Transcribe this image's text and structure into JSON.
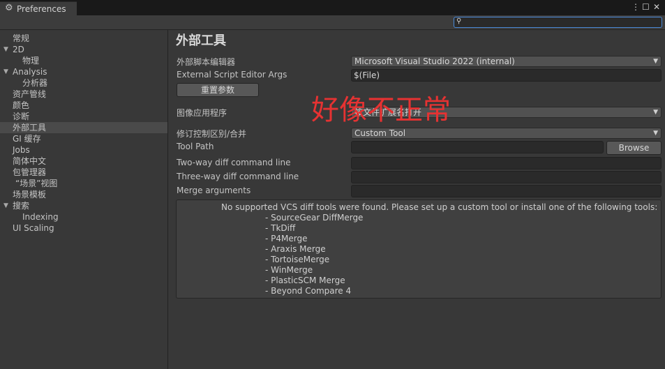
{
  "window": {
    "title": "Preferences",
    "buttons": [
      "⋮",
      "☐",
      "✕"
    ]
  },
  "search": {
    "value": "",
    "placeholder": ""
  },
  "sidebar": {
    "items": [
      {
        "label": "常规",
        "indent": 0,
        "arrow": "",
        "selected": false
      },
      {
        "label": "2D",
        "indent": 0,
        "arrow": "▼",
        "selected": false
      },
      {
        "label": "物理",
        "indent": 1,
        "arrow": "",
        "selected": false
      },
      {
        "label": "Analysis",
        "indent": 0,
        "arrow": "▼",
        "selected": false
      },
      {
        "label": "分析器",
        "indent": 1,
        "arrow": "",
        "selected": false
      },
      {
        "label": "资产管线",
        "indent": 0,
        "arrow": "",
        "selected": false
      },
      {
        "label": "颜色",
        "indent": 0,
        "arrow": "",
        "selected": false
      },
      {
        "label": "诊断",
        "indent": 0,
        "arrow": "",
        "selected": false
      },
      {
        "label": "外部工具",
        "indent": 0,
        "arrow": "",
        "selected": true
      },
      {
        "label": "GI 缓存",
        "indent": 0,
        "arrow": "",
        "selected": false
      },
      {
        "label": "Jobs",
        "indent": 0,
        "arrow": "",
        "selected": false
      },
      {
        "label": "简体中文",
        "indent": 0,
        "arrow": "",
        "selected": false
      },
      {
        "label": "包管理器",
        "indent": 0,
        "arrow": "",
        "selected": false
      },
      {
        "label": "“场景”视图",
        "indent": 1,
        "arrow": "",
        "selected": false
      },
      {
        "label": "场景模板",
        "indent": 0,
        "arrow": "",
        "selected": false
      },
      {
        "label": "搜索",
        "indent": 0,
        "arrow": "▼",
        "selected": false
      },
      {
        "label": "Indexing",
        "indent": 1,
        "arrow": "",
        "selected": false
      },
      {
        "label": "UI Scaling",
        "indent": 0,
        "arrow": "",
        "selected": false
      }
    ]
  },
  "main": {
    "heading": "外部工具",
    "external_editor_label": "外部脚本编辑器",
    "external_editor_value": "Microsoft Visual Studio 2022 (internal)",
    "editor_args_label": "External Script Editor Args",
    "editor_args_value": "$(File)",
    "reset_button": "重置参数",
    "image_app_label": "图像应用程序",
    "image_app_value": "按文件扩展名打开",
    "revision_label": "修订控制区别/合并",
    "revision_value": "Custom Tool",
    "tool_path_label": "Tool Path",
    "tool_path_value": "",
    "browse_button": "Browse",
    "two_way_label": "Two-way diff command line",
    "two_way_value": "",
    "three_way_label": "Three-way diff command line",
    "three_way_value": "",
    "merge_args_label": "Merge arguments",
    "merge_args_value": "",
    "help_message": "No supported VCS diff tools were found. Please set up a custom tool or install one of the following tools:",
    "tools": [
      "- SourceGear DiffMerge",
      "- TkDiff",
      "- P4Merge",
      "- Araxis Merge",
      "- TortoiseMerge",
      "- WinMerge",
      "- PlasticSCM Merge",
      "- Beyond Compare 4"
    ]
  },
  "overlay_text": "好像不正常",
  "colors": {
    "background": "#383838",
    "selected_item": "#4a4a4a",
    "search_focus": "#4a8ad8",
    "overlay": "#e63232"
  },
  "icons": {
    "tab": "gear-icon",
    "search": "search-icon",
    "dropdown": "chevron-down-icon",
    "tree": "triangle-down-icon"
  }
}
